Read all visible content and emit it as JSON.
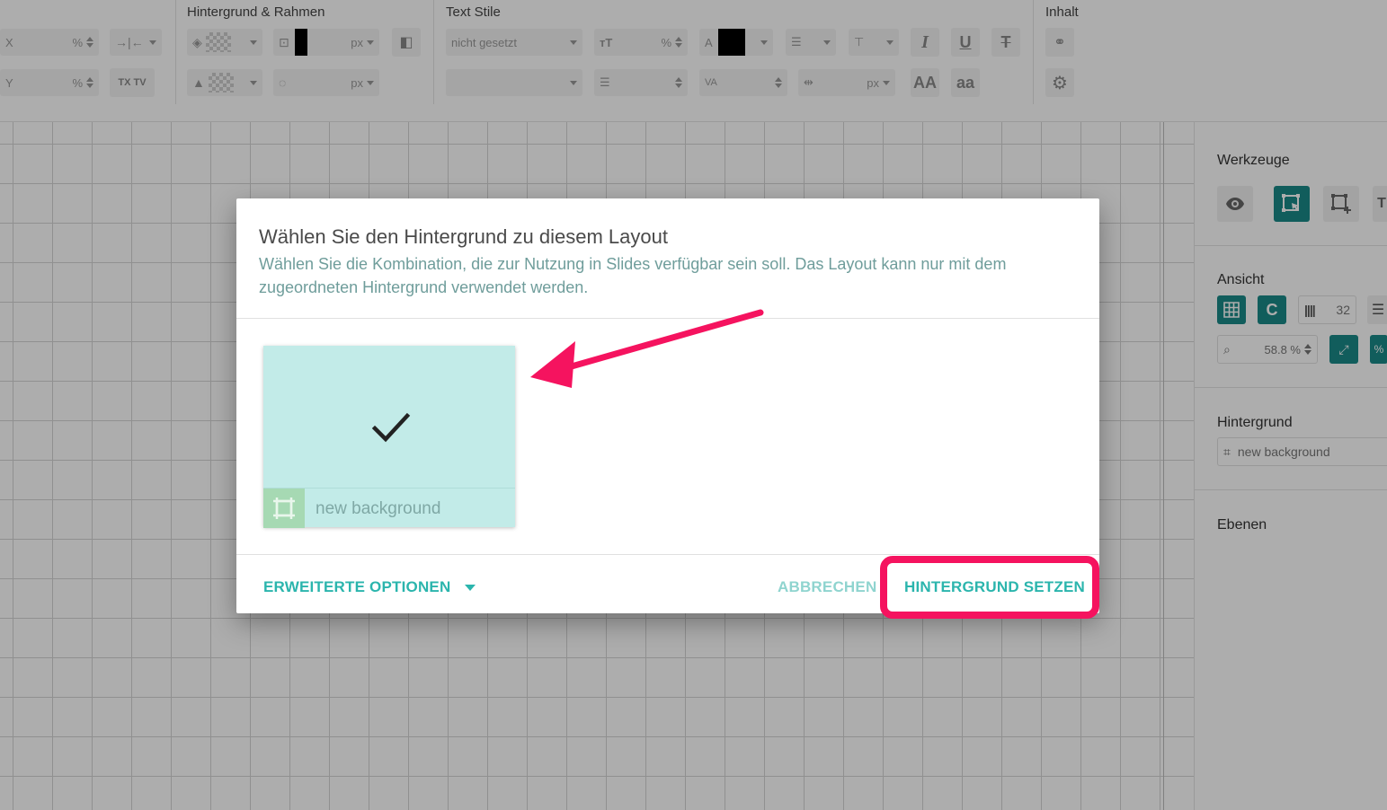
{
  "toolbar": {
    "groups": {
      "hintergrund_rahmen": "Hintergrund & Rahmen",
      "text_stile": "Text Stile",
      "inhalt": "Inhalt"
    },
    "position": {
      "x_label": "X",
      "y_label": "Y",
      "unit": "%"
    },
    "border": {
      "width_unit": "px",
      "radius_unit": "px"
    },
    "text": {
      "font_value": "nicht gesetzt",
      "size_unit": "%",
      "spacing_unit": "px",
      "font_color": "#000000"
    }
  },
  "right_panel": {
    "werkzeuge": "Werkzeuge",
    "ansicht": "Ansicht",
    "grid_count": "32",
    "zoom": "58.8 %",
    "hintergrund": "Hintergrund",
    "hintergrund_value": "new background",
    "ebenen": "Ebenen",
    "accent": "#1a8a88"
  },
  "dialog": {
    "title": "Wählen Sie den Hintergrund zu diesem Layout",
    "subtitle": "Wählen Sie die Kombination, die zur Nutzung in Slides verfügbar sein soll. Das Layout kann nur mit dem zugeordneten Hintergrund verwendet werden.",
    "card": {
      "label": "new background",
      "selected": true,
      "icon": "check-icon"
    },
    "advanced_options": "ERWEITERTE OPTIONEN",
    "cancel": "ABBRECHEN",
    "set_background": "HINTERGRUND SETZEN",
    "accent_color": "#2bb5ad",
    "annotation_color": "#f5135f"
  }
}
